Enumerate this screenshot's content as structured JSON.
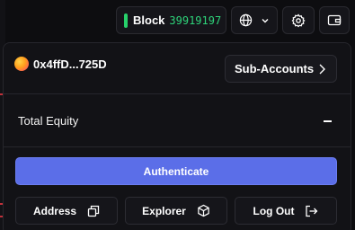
{
  "topbar": {
    "block_label": "Block",
    "block_number": "39919197",
    "status_color": "#27d16b",
    "language_icon": "globe-icon",
    "settings_icon": "gear-icon",
    "wallet_icon": "wallet-icon"
  },
  "account": {
    "address": "0x4ffD...725D",
    "sub_accounts_label": "Sub-Accounts"
  },
  "equity": {
    "label": "Total Equity",
    "value": "-"
  },
  "actions": {
    "authenticate_label": "Authenticate",
    "authenticate_color": "#5b6ee8",
    "address_label": "Address",
    "explorer_label": "Explorer",
    "logout_label": "Log Out"
  }
}
